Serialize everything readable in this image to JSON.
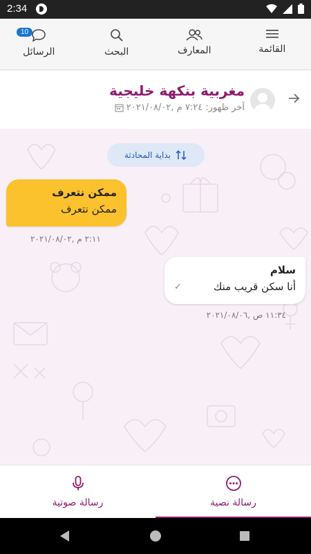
{
  "status_bar": {
    "time": "2:34"
  },
  "top_nav": {
    "items": [
      {
        "label": "القائمة",
        "icon": "menu-icon"
      },
      {
        "label": "المعارف",
        "icon": "contacts-icon"
      },
      {
        "label": "البحث",
        "icon": "search-icon"
      },
      {
        "label": "الرسائل",
        "icon": "chat-bubble-icon",
        "badge": "10"
      }
    ]
  },
  "chat_header": {
    "name": "مغربية بنكهة خليجية",
    "last_seen": "آخر ظهور: ٧:٢٤ م ,٢٠٢١/٠٨/٠٢"
  },
  "conversation": {
    "start_label": "بداية المحادثة",
    "messages": [
      {
        "direction": "incoming",
        "title": "ممكن نتعرف",
        "body": "ممكن نتعرف",
        "time": "٢:١١ م ,٢٠٢١/٠٨/٠٢"
      },
      {
        "direction": "outgoing",
        "title": "سلام",
        "body": "أنا سكن قريب منك",
        "time": "١١:٣٤ ص ,٢٠٢١/٠٨/٠٦"
      }
    ]
  },
  "bottom_tabs": [
    {
      "label": "رسالة نصية",
      "icon": "chat-dots-icon",
      "active": true
    },
    {
      "label": "رسالة صوتية",
      "icon": "microphone-icon",
      "active": false
    }
  ],
  "colors": {
    "accent": "#8e1b6f",
    "incoming_bubble": "#fbc22d",
    "badge": "#1976d2",
    "conversation_start_bg": "#dfe8f7"
  }
}
